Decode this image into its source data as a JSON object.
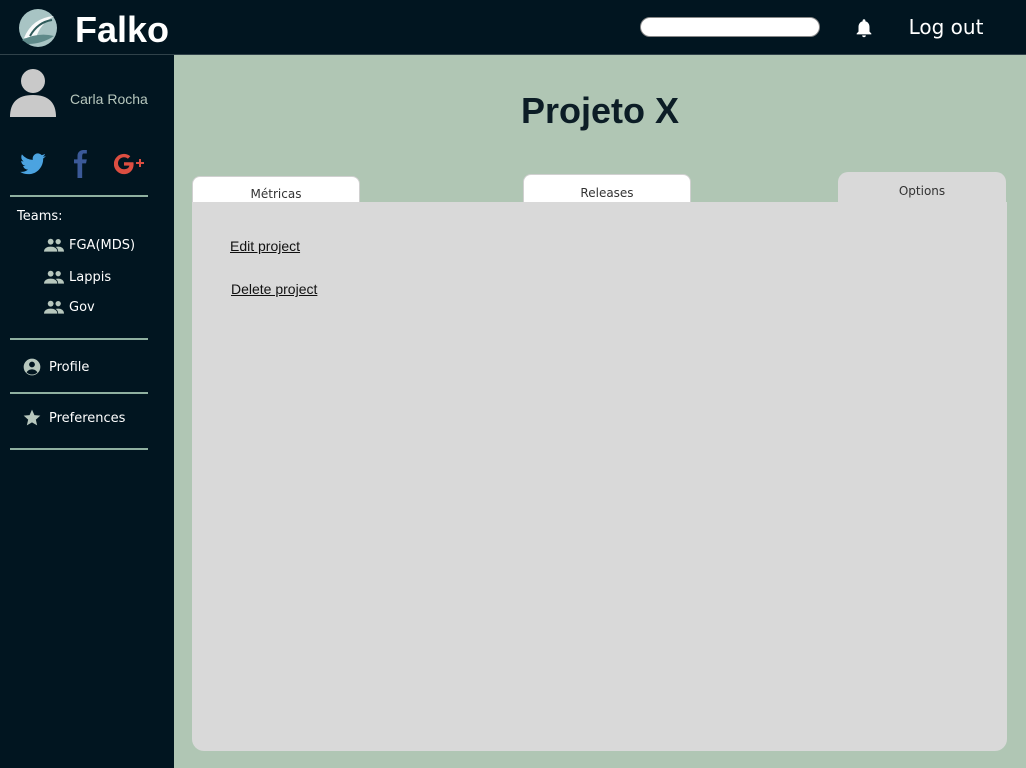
{
  "header": {
    "brand": "Falko",
    "search": {
      "value": "",
      "placeholder": ""
    },
    "logout_label": "Log out"
  },
  "sidebar": {
    "user_name": "Carla Rocha",
    "social": [
      "twitter-icon",
      "facebook-icon",
      "google-plus-icon"
    ],
    "teams_label": "Teams:",
    "teams": [
      {
        "label": "FGA(MDS)",
        "icon": "group-icon"
      },
      {
        "label": "Lappis",
        "icon": "group-icon"
      },
      {
        "label": "Gov",
        "icon": "group-icon"
      }
    ],
    "nav": [
      {
        "label": "Profile",
        "icon": "account-circle-icon"
      },
      {
        "label": "Preferences",
        "icon": "star-icon"
      }
    ]
  },
  "main": {
    "title": "Projeto X",
    "tabs": [
      {
        "label": "Métricas"
      },
      {
        "label": "Releases"
      },
      {
        "label": "Options",
        "active": true
      }
    ],
    "options": {
      "edit_label": "Edit project",
      "delete_label": "Delete project"
    }
  },
  "colors": {
    "sidebar_bg": "#011520",
    "page_bg": "#b0c6b4",
    "panel_bg": "#d9d9d9",
    "divider": "#8fb0a0",
    "twitter": "#4ba3e0",
    "facebook": "#3b5998",
    "google": "#dc4e41"
  }
}
